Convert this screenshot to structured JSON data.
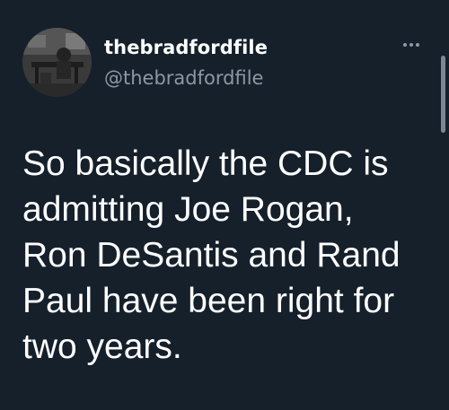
{
  "tweet": {
    "author": {
      "display_name": "thebradfordfile",
      "handle": "@thebradfordfile",
      "avatar": "profile-photo"
    },
    "more_icon": "more-dots-icon",
    "text": "So basically the CDC is\nadmitting Joe Rogan,\nRon DeSantis and Rand\nPaul have been right for\ntwo years."
  },
  "colors": {
    "background": "#15202b",
    "primary_text": "#ffffff",
    "secondary_text": "#8b98a5"
  }
}
